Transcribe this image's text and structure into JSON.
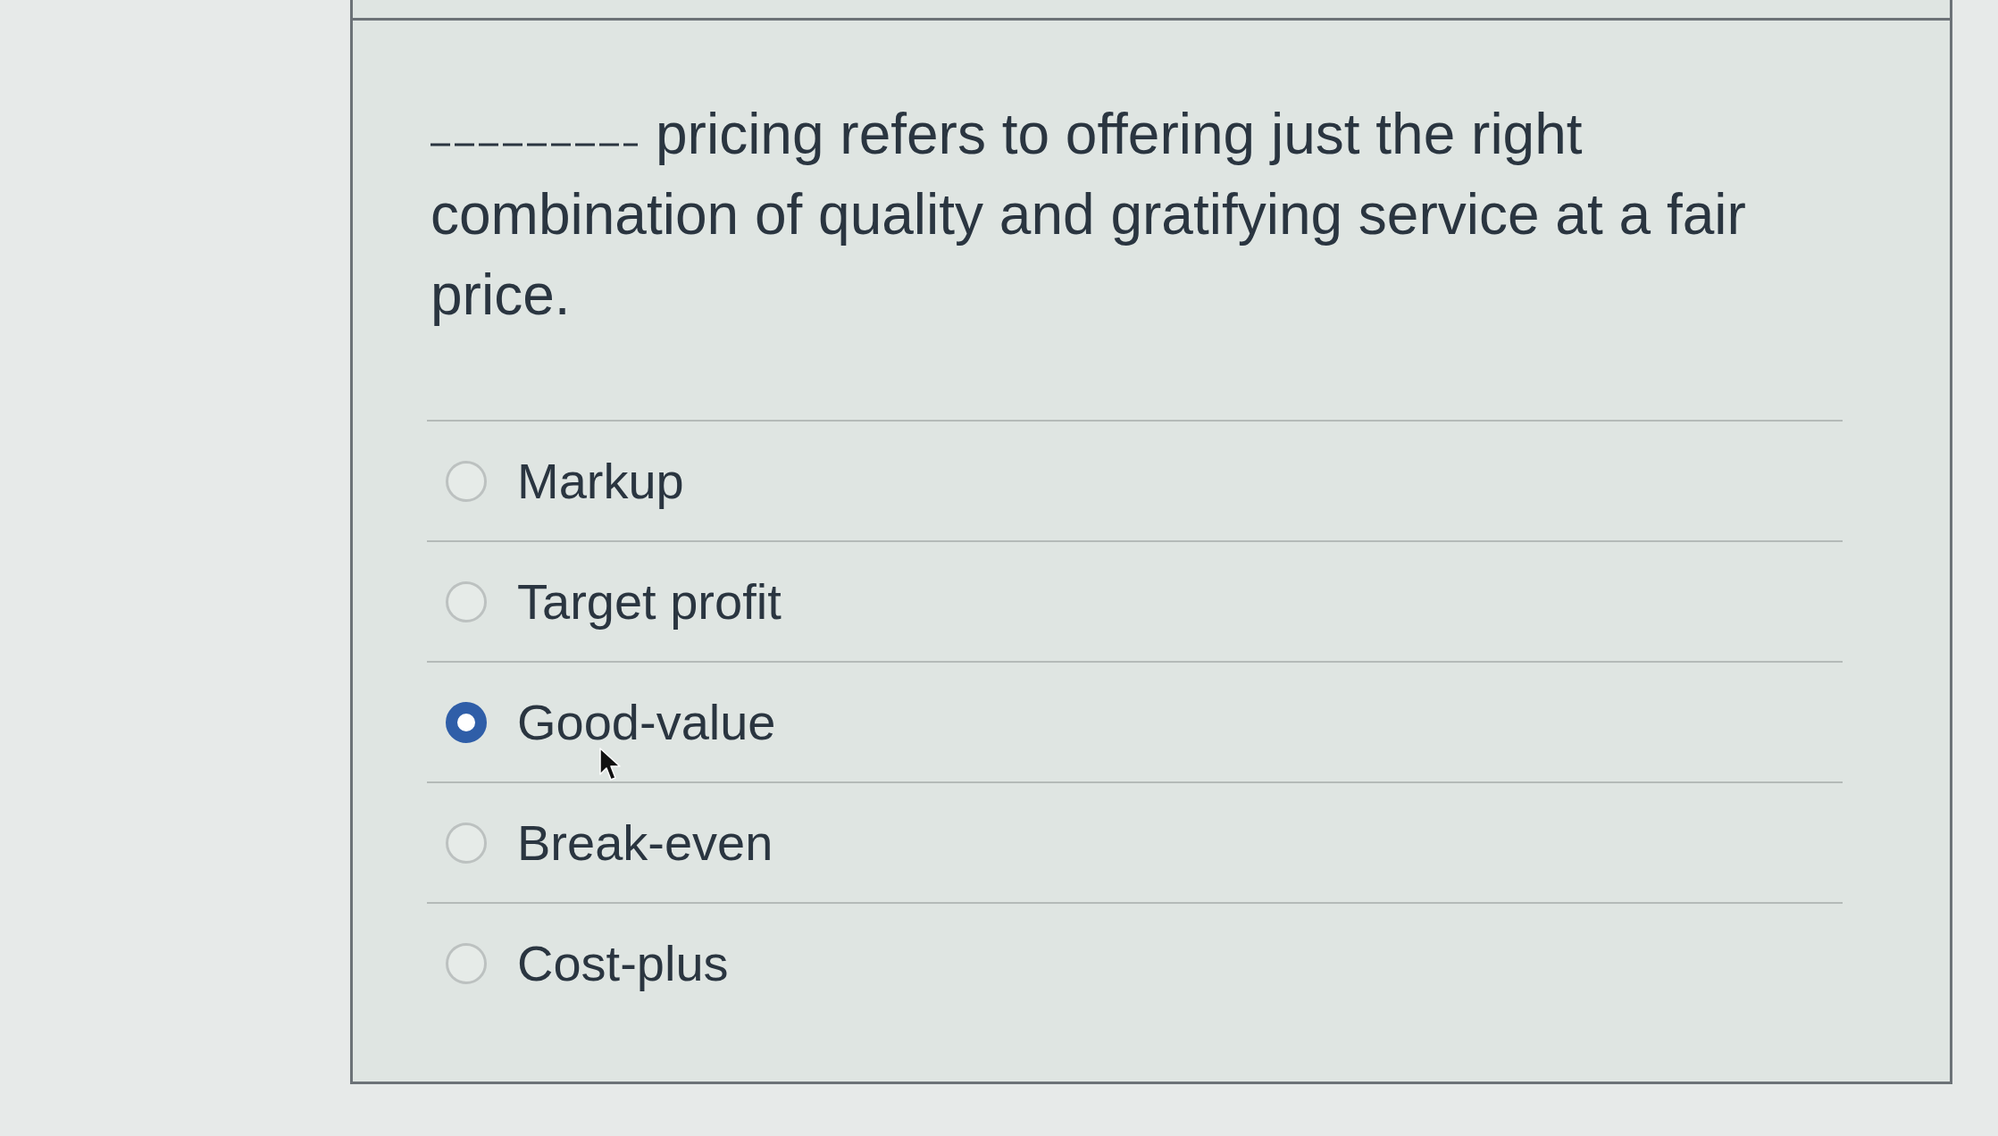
{
  "question": {
    "leading_blank": true,
    "text": "pricing refers to offering just the right combination of quality and gratifying service at a fair price."
  },
  "options": [
    {
      "label": "Markup",
      "selected": false,
      "hovered": false
    },
    {
      "label": "Target profit",
      "selected": false,
      "hovered": false
    },
    {
      "label": "Good-value",
      "selected": true,
      "hovered": true
    },
    {
      "label": "Break-even",
      "selected": false,
      "hovered": false
    },
    {
      "label": "Cost-plus",
      "selected": false,
      "hovered": false
    }
  ]
}
